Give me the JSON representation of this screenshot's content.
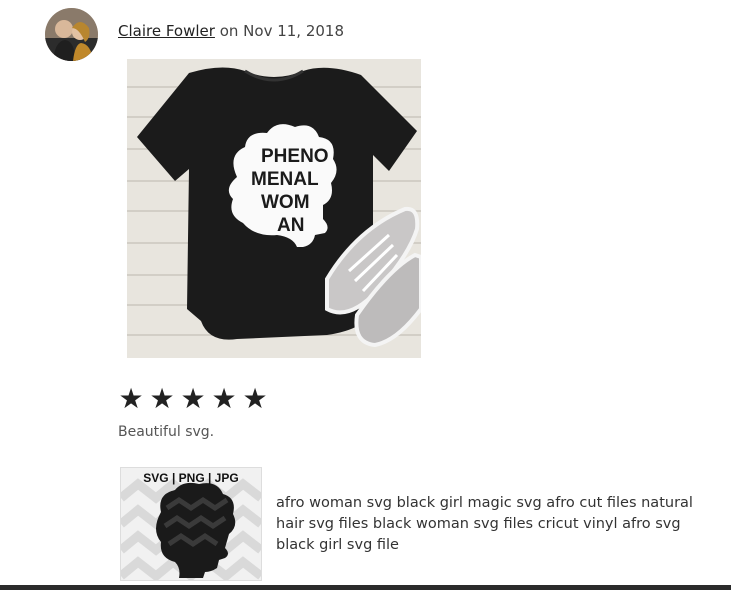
{
  "review": {
    "reviewer_name": "Claire Fowler",
    "date_text": "on Nov 11, 2018",
    "rating": 5,
    "stars": [
      "★",
      "★",
      "★",
      "★",
      "★"
    ],
    "text": "Beautiful svg.",
    "photo_text": {
      "line1": "PHENO",
      "line2": "MENAL",
      "line3": "WOM",
      "line4": "AN"
    }
  },
  "listing": {
    "thumbnail_label": "SVG | PNG | JPG",
    "title": "afro woman svg black girl magic svg afro cut files natural hair svg files black woman svg files cricut vinyl afro svg black girl svg file"
  },
  "colors": {
    "star": "#222222",
    "text_muted": "#555555",
    "bar": "#2b2b2b"
  }
}
